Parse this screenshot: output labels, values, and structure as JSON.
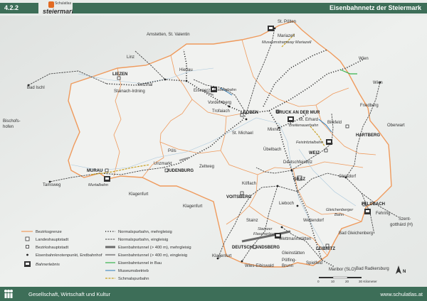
{
  "header": {
    "section": "4.2.2",
    "logo_small": "Schulatlas",
    "logo_main": "steiermark",
    "title": "Eisenbahnnetz der Steiermark"
  },
  "footer": {
    "subject": "Gesellschaft, Wirtschaft und Kultur",
    "url": "www.schulatlas.at"
  },
  "colors": {
    "brand": "#3d6e58",
    "border": "#ef9a5c",
    "tunnel_build": "#37b24d",
    "museum": "#2b7bb9",
    "narrow": "#c9a227",
    "rail": "#333333"
  },
  "places": [
    {
      "name": "St. Pölten",
      "style": "n"
    },
    {
      "name": "Mariazell",
      "style": "n"
    },
    {
      "name": "Museumstramway Mariazell",
      "style": "i"
    },
    {
      "name": "Amstetten, St. Valentin",
      "style": "n"
    },
    {
      "name": "Wien",
      "style": "n"
    },
    {
      "name": "Wien",
      "style": "n"
    },
    {
      "name": "Linz",
      "style": "n"
    },
    {
      "name": "LIEZEN",
      "style": "b"
    },
    {
      "name": "Hieflau",
      "style": "n"
    },
    {
      "name": "Selzthal",
      "style": "n"
    },
    {
      "name": "Bad Ischl",
      "style": "n"
    },
    {
      "name": "Stainach-Irdning",
      "style": "n"
    },
    {
      "name": "Eisenerz",
      "style": "n"
    },
    {
      "name": "Erzbergbahn",
      "style": "i"
    },
    {
      "name": "Vordernberg",
      "style": "n"
    },
    {
      "name": "Trofaiach",
      "style": "n"
    },
    {
      "name": "LEOBEN",
      "style": "b"
    },
    {
      "name": "BRUCK AN DER MUR",
      "style": "b"
    },
    {
      "name": "Mixnitz",
      "style": "n"
    },
    {
      "name": "St. Erhard",
      "style": "n"
    },
    {
      "name": "Breitenauerbahn",
      "style": "i"
    },
    {
      "name": "Friedberg",
      "style": "n"
    },
    {
      "name": "Oberwart",
      "style": "n"
    },
    {
      "name": "Bischofs-",
      "style": "n"
    },
    {
      "name": "hofen",
      "style": "n"
    },
    {
      "name": "St. Michael",
      "style": "n"
    },
    {
      "name": "Birkfeld",
      "style": "n"
    },
    {
      "name": "Feistritztalbahn",
      "style": "i"
    },
    {
      "name": "HARTBERG",
      "style": "b"
    },
    {
      "name": "Übelbach",
      "style": "n"
    },
    {
      "name": "WEIZ",
      "style": "b"
    },
    {
      "name": "Pöls",
      "style": "n"
    },
    {
      "name": "Deutschfeistritz",
      "style": "n"
    },
    {
      "name": "MURAU",
      "style": "b"
    },
    {
      "name": "Unzmarkt",
      "style": "n"
    },
    {
      "name": "JUDENBURG",
      "style": "b"
    },
    {
      "name": "Zeltweg",
      "style": "n"
    },
    {
      "name": "Gleisdorf",
      "style": "n"
    },
    {
      "name": "Tamsweg",
      "style": "n"
    },
    {
      "name": "Murtalbahn",
      "style": "i"
    },
    {
      "name": "Köflach",
      "style": "n"
    },
    {
      "name": "GRAZ",
      "style": "b"
    },
    {
      "name": "VOITSBERG",
      "style": "b"
    },
    {
      "name": "FELDBACH",
      "style": "b"
    },
    {
      "name": "Klagenfurt",
      "style": "n"
    },
    {
      "name": "Klagenfurt",
      "style": "n"
    },
    {
      "name": "Lieboch",
      "style": "n"
    },
    {
      "name": "Gleichenberger",
      "style": "i"
    },
    {
      "name": "Bahn",
      "style": "i"
    },
    {
      "name": "Fehring",
      "style": "n"
    },
    {
      "name": "Szent-",
      "style": "n"
    },
    {
      "name": "gotthárd (H)",
      "style": "n"
    },
    {
      "name": "Stainz",
      "style": "n"
    },
    {
      "name": "Weitendorf",
      "style": "n"
    },
    {
      "name": "Bad Gleichenberg",
      "style": "n"
    },
    {
      "name": "Stainzer",
      "style": "i"
    },
    {
      "name": "Flascherlzug",
      "style": "i"
    },
    {
      "name": "Wettmannstätten",
      "style": "n"
    },
    {
      "name": "DEUTSCHLANDSBERG",
      "style": "b"
    },
    {
      "name": "LEIBNITZ",
      "style": "b"
    },
    {
      "name": "Klagenfurt",
      "style": "n"
    },
    {
      "name": "Gleinstätten",
      "style": "n"
    },
    {
      "name": "Pölfing-",
      "style": "n"
    },
    {
      "name": "Brunn",
      "style": "n"
    },
    {
      "name": "Wies-Eibiswald",
      "style": "n"
    },
    {
      "name": "Spielfeld",
      "style": "n"
    },
    {
      "name": "Maribor (SLO)",
      "style": "n"
    },
    {
      "name": "Bad Radkersburg",
      "style": "n"
    }
  ],
  "legend": {
    "col1": [
      {
        "label": "Bezirksgrenze",
        "style": "n"
      },
      {
        "label": "Landeshauptstadt",
        "style": "n"
      },
      {
        "label": "Bezirkshauptstadt",
        "style": "n"
      },
      {
        "label": "Eisenbahnknotenpunkt, Endbahnhof",
        "style": "n"
      },
      {
        "label": "Bahnerlebnis",
        "style": "i"
      }
    ],
    "col2": [
      {
        "label": "Normalspurbahn, mehrgleisig"
      },
      {
        "label": "Normalspurbahn, eingleisig"
      },
      {
        "label": "Eisenbahntunnel (> 400 m), mehrgleisig"
      },
      {
        "label": "Eisenbahntunnel (> 400 m), eingleisig"
      },
      {
        "label": "Eisenbahntunnel in Bau"
      },
      {
        "label": "Museumsbetrieb"
      },
      {
        "label": "Schmalspurbahn"
      }
    ]
  },
  "scale": {
    "ticks": [
      "0",
      "10",
      "20",
      "30 Kilometer"
    ]
  },
  "north": "N"
}
